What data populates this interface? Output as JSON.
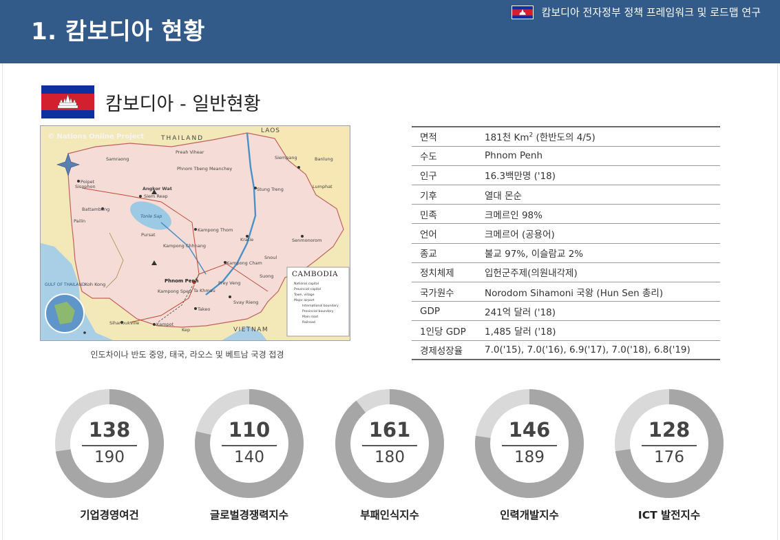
{
  "header": {
    "title": "1. 캄보디아 현황",
    "subtitle": "캄보디아 전자정부 정책 프레임워크 및 로드맵 연구",
    "flag_colors": {
      "blue": "#0d2fa0",
      "red": "#d3202e"
    }
  },
  "section": {
    "title": "캄보디아 - 일반현황",
    "flag_icon": "cambodia-flag-icon"
  },
  "map": {
    "watermark": "© Nations Online Project",
    "country_label": "CAMBODIA",
    "neighbors": {
      "north_west": "THAILAND",
      "north": "LAOS",
      "south_east": "VIETNAM",
      "gulf": "GULF OF THAILAND"
    },
    "places": [
      "Phnom Penh",
      "Siem Reap",
      "Angkor Wat",
      "Battambang",
      "Kampong Cham",
      "Kampong Thom",
      "Kratie",
      "Stung Treng",
      "Sihanoukville",
      "Kampot",
      "Takeo",
      "Prey Veng",
      "Svay Rieng",
      "Poipet",
      "Pailin",
      "Pursat",
      "Koh Kong",
      "Kampong Speu",
      "Ta Khmau",
      "Senmonorom",
      "Banlung",
      "Lumphat",
      "Siempang",
      "Preah Vihear",
      "Phnom Tbeng Meanchey",
      "Sisophon",
      "Samraong",
      "Kampong Chhnang",
      "Snoul",
      "Suong",
      "Kep"
    ],
    "lake_label": "Tonle Sap",
    "legend": [
      "National capital",
      "Provincial capital",
      "Town, village",
      "Major airport",
      "International boundary",
      "Provincial boundary",
      "Main road",
      "Railroad"
    ],
    "caption": "인도차이나 반도 중앙, 태국, 라오스 및 베트남 국경 접경"
  },
  "info": {
    "rows": [
      {
        "key": "면적",
        "value": "181천 Km",
        "sup": "2",
        "value_after": " (한반도의 4/5)"
      },
      {
        "key": "수도",
        "value": "Phnom Penh"
      },
      {
        "key": "인구",
        "value": "16.3백만명 ('18)"
      },
      {
        "key": "기후",
        "value": "열대 몬순"
      },
      {
        "key": "민족",
        "value": "크메르인 98%"
      },
      {
        "key": "언어",
        "value": "크메르어 (공용어)"
      },
      {
        "key": "종교",
        "value": "불교 97%, 이슬람교 2%"
      },
      {
        "key": "정치체제",
        "value": "입헌군주제(의원내각제)"
      },
      {
        "key": "국가원수",
        "value": "Norodom Sihamoni 국왕 (Hun Sen 총리)"
      },
      {
        "key": "GDP",
        "value": "241억 달러 ('18)"
      },
      {
        "key": "1인당 GDP",
        "value": "1,485 달러 ('18)"
      },
      {
        "key": "경제성장율",
        "value": "7.0('15), 7.0('16), 6.9('17), 7.0('18), 6.8('19)"
      }
    ]
  },
  "gauges": {
    "ring_color": "#a6a6a6",
    "track_color": "#d9d9d9",
    "items": [
      {
        "rank": "138",
        "total": "190",
        "label": "기업경영여건",
        "name": "gauge-business"
      },
      {
        "rank": "110",
        "total": "140",
        "label": "글로벌경쟁력지수",
        "name": "gauge-competitiveness"
      },
      {
        "rank": "161",
        "total": "180",
        "label": "부패인식지수",
        "name": "gauge-corruption"
      },
      {
        "rank": "146",
        "total": "189",
        "label": "인력개발지수",
        "name": "gauge-hrd"
      },
      {
        "rank": "128",
        "total": "176",
        "label": "ICT 발전지수",
        "name": "gauge-ict"
      }
    ]
  }
}
